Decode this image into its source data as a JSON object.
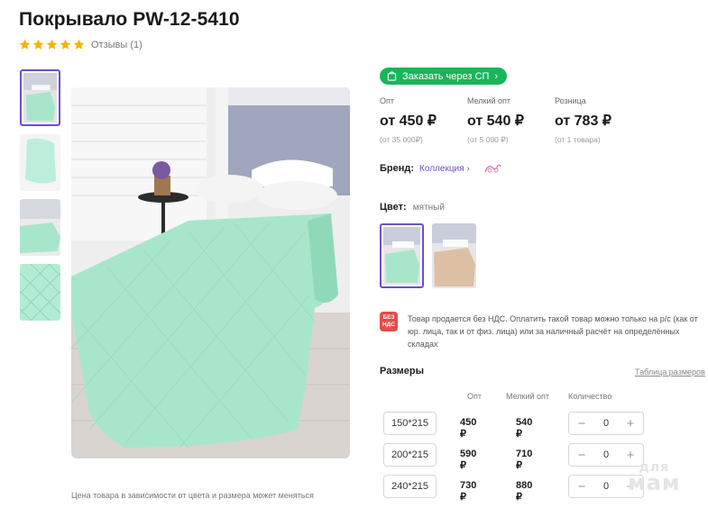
{
  "product": {
    "title": "Покрывало PW-12-5410",
    "rating_stars": 5,
    "reviews": "Отзывы (1)"
  },
  "order_button": {
    "label": "Заказать через СП",
    "icon": "shopping-bag-icon"
  },
  "prices": [
    {
      "label": "Опт",
      "value": "от 450 ₽",
      "sub": "(от 35 000₽)"
    },
    {
      "label": "Мелкий опт",
      "value": "от 540 ₽",
      "sub": "(от 5 000 ₽)"
    },
    {
      "label": "Розница",
      "value": "от 783 ₽",
      "sub": "(от 1 товара)"
    }
  ],
  "brand": {
    "label": "Бренд:",
    "value": "Коллекция"
  },
  "color": {
    "label": "Цвет:",
    "value": "мятный"
  },
  "vat": {
    "badge": [
      "БЕЗ",
      "НДС"
    ],
    "text": "Товар продается без НДС. Оплатить такой товар можно только на р/с (как от юр. лица, так и от физ. лица) или за наличный расчёт на определённых складах"
  },
  "sizes": {
    "title": "Размеры",
    "table_link": "Таблица размеров",
    "headers": {
      "opt": "Опт",
      "small_opt": "Мелкий опт",
      "qty": "Количество"
    },
    "rows": [
      {
        "size": "150*215",
        "opt": "450 ₽",
        "small_opt": "540 ₽",
        "qty": "0"
      },
      {
        "size": "200*215",
        "opt": "590 ₽",
        "small_opt": "710 ₽",
        "qty": "0"
      },
      {
        "size": "240*215",
        "opt": "730 ₽",
        "small_opt": "880 ₽",
        "qty": "0"
      }
    ]
  },
  "price_note": "Цена товара в зависимости от цвета и размера может меняться",
  "watermark": [
    "для",
    "мам"
  ],
  "colors": {
    "accent": "#6b4fc7",
    "green": "#19b55a",
    "star": "#f5b400",
    "mint": "#a8e6cc",
    "vat_red": "#e94a4a"
  }
}
